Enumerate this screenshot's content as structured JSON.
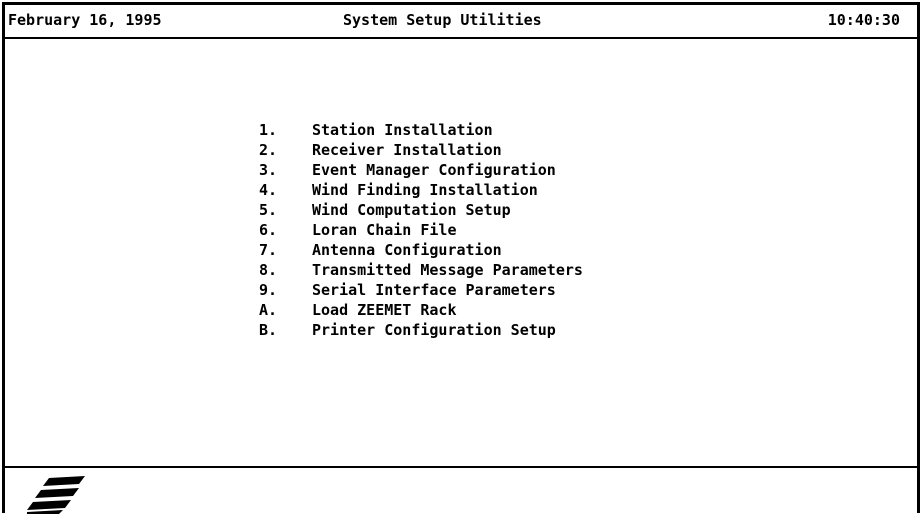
{
  "header": {
    "date": "February 16, 1995",
    "title": "System Setup Utilities",
    "time": "10:40:30"
  },
  "menu": {
    "items": [
      {
        "key": "1.",
        "label": "Station Installation"
      },
      {
        "key": "2.",
        "label": "Receiver Installation"
      },
      {
        "key": "3.",
        "label": "Event Manager Configuration"
      },
      {
        "key": "4.",
        "label": "Wind Finding Installation"
      },
      {
        "key": "5.",
        "label": "Wind Computation Setup"
      },
      {
        "key": "6.",
        "label": "Loran Chain File"
      },
      {
        "key": "7.",
        "label": "Antenna Configuration"
      },
      {
        "key": "8.",
        "label": "Transmitted Message Parameters"
      },
      {
        "key": "9.",
        "label": "Serial Interface Parameters"
      },
      {
        "key": "A.",
        "label": "Load ZEEMET Rack"
      },
      {
        "key": "B.",
        "label": "Printer Configuration Setup"
      }
    ]
  },
  "logo": {
    "icon": "company-logo-stripes-icon",
    "color": "#000000"
  }
}
